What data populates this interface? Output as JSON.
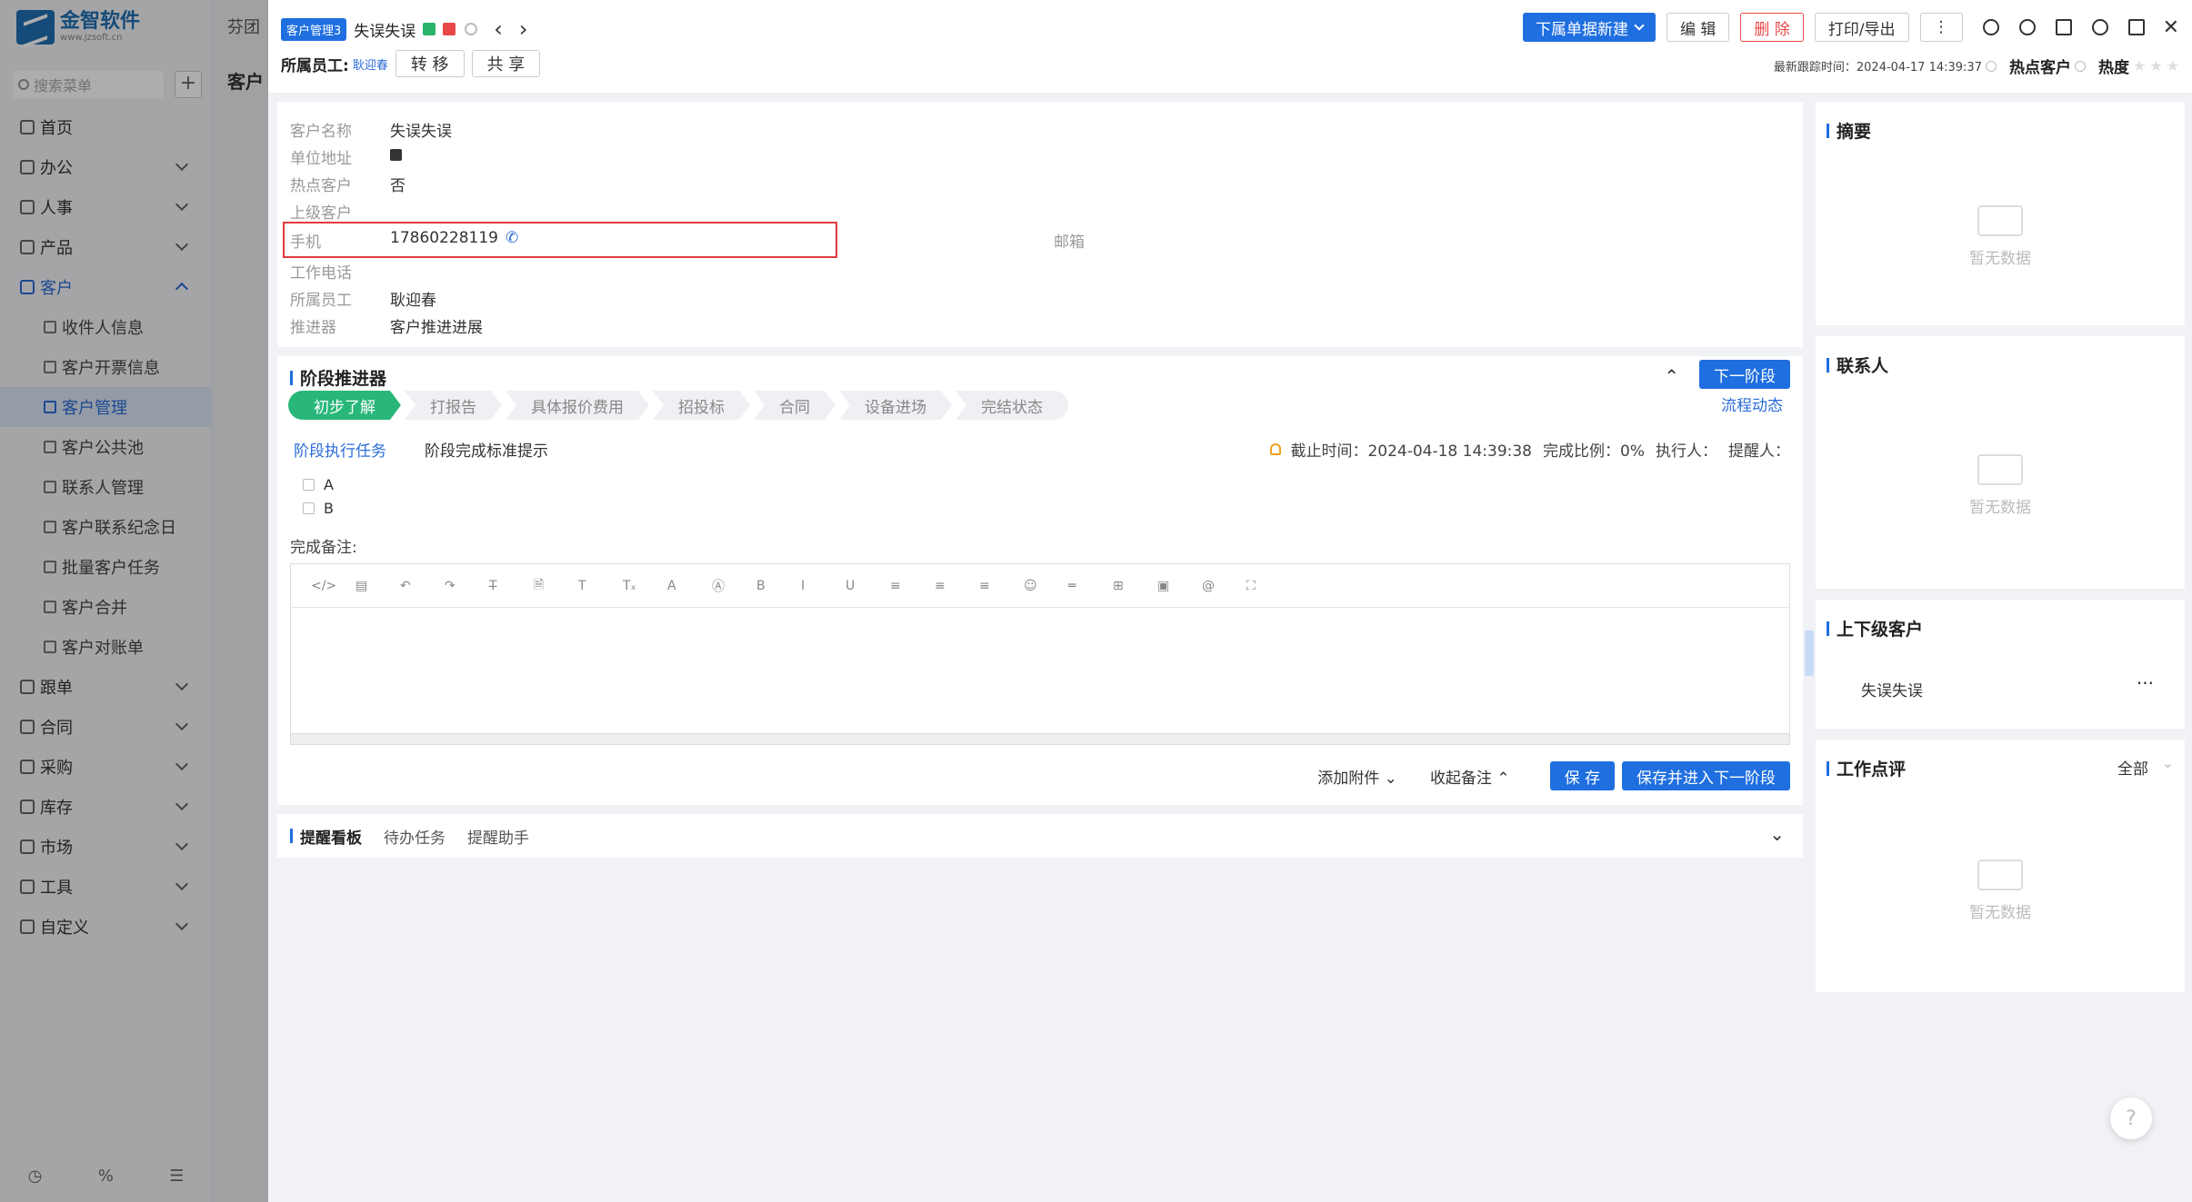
{
  "sidebar": {
    "logo_title": "金智软件",
    "logo_sub": "www.jzsoft.cn",
    "search_placeholder": "搜索菜单",
    "plus": "+",
    "menu": [
      {
        "label": "首页",
        "icon": "home-icon"
      },
      {
        "label": "办公",
        "icon": "office-icon"
      },
      {
        "label": "人事",
        "icon": "person-icon"
      },
      {
        "label": "产品",
        "icon": "cube-icon"
      },
      {
        "label": "客户",
        "icon": "chart-icon"
      }
    ],
    "sub_items": [
      "收件人信息",
      "客户开票信息",
      "客户管理",
      "客户公共池",
      "联系人管理",
      "客户联系纪念日",
      "批量客户任务",
      "客户合并",
      "客户对账单"
    ],
    "menu2": [
      "跟单",
      "合同",
      "采购",
      "库存",
      "市场",
      "工具",
      "自定义"
    ],
    "footer": [
      "history-icon",
      "percent-icon",
      "list-icon"
    ]
  },
  "background": {
    "tab": "芬团",
    "title": "客户"
  },
  "header": {
    "tag": "客户管理3",
    "customer_name": "失误失误",
    "owner_label": "所属员工:",
    "owner_name": "耿迎春",
    "transfer": "转 移",
    "share": "共 享",
    "new_btn": "下属单据新建",
    "edit": "编 辑",
    "delete": "删 除",
    "print": "打印/导出",
    "more": "⋮",
    "last_follow": "最新跟踪时间：2024-04-17 14:39:37",
    "hot_label": "热点客户",
    "heat_label": "热度"
  },
  "info": {
    "fields": [
      {
        "label": "客户名称",
        "value": "失误失误"
      },
      {
        "label": "单位地址",
        "value": ""
      },
      {
        "label": "热点客户",
        "value": "否"
      },
      {
        "label": "上级客户",
        "value": ""
      },
      {
        "label": "手机",
        "value": "17860228119"
      },
      {
        "label": "工作电话",
        "value": ""
      },
      {
        "label": "所属员工",
        "value": "耿迎春"
      },
      {
        "label": "推进器",
        "value": "客户推进进展"
      }
    ],
    "email_label": "邮箱"
  },
  "stage": {
    "title": "阶段推进器",
    "next_btn": "下一阶段",
    "flow_link": "流程动态",
    "steps": [
      "初步了解",
      "打报告",
      "具体报价费用",
      "招投标",
      "合同",
      "设备进场",
      "完结状态"
    ],
    "tab_task": "阶段执行任务",
    "tab_hint": "阶段完成标准提示",
    "deadline": "截止时间：2024-04-18 14:39:38",
    "ratio": "完成比例：0%",
    "executor": "执行人：",
    "reminder": "提醒人：",
    "tasks": [
      "A",
      "B"
    ],
    "note_label": "完成备注:",
    "add_attach": "添加附件 ⌄",
    "collapse_note": "收起备注 ⌃",
    "save": "保 存",
    "save_next": "保存并进入下一阶段"
  },
  "toolbar_icons": [
    "</>",
    "▤",
    "↶",
    "↷",
    "T̶",
    "🗎",
    "T",
    "Tₓ",
    "A",
    "Ⓐ",
    "B",
    "I",
    "U",
    "≡",
    "≡",
    "≡",
    "☺",
    "═",
    "⊞",
    "▣",
    "@",
    "⛶"
  ],
  "remind": {
    "title": "提醒看板",
    "todo": "待办任务",
    "assistant": "提醒助手"
  },
  "right": {
    "summary": "摘要",
    "contacts": "联系人",
    "parent_child": "上下级客户",
    "related_customer": "失误失误",
    "work_review": "工作点评",
    "filter_all": "全部",
    "empty": "暂无数据"
  },
  "help": "?"
}
